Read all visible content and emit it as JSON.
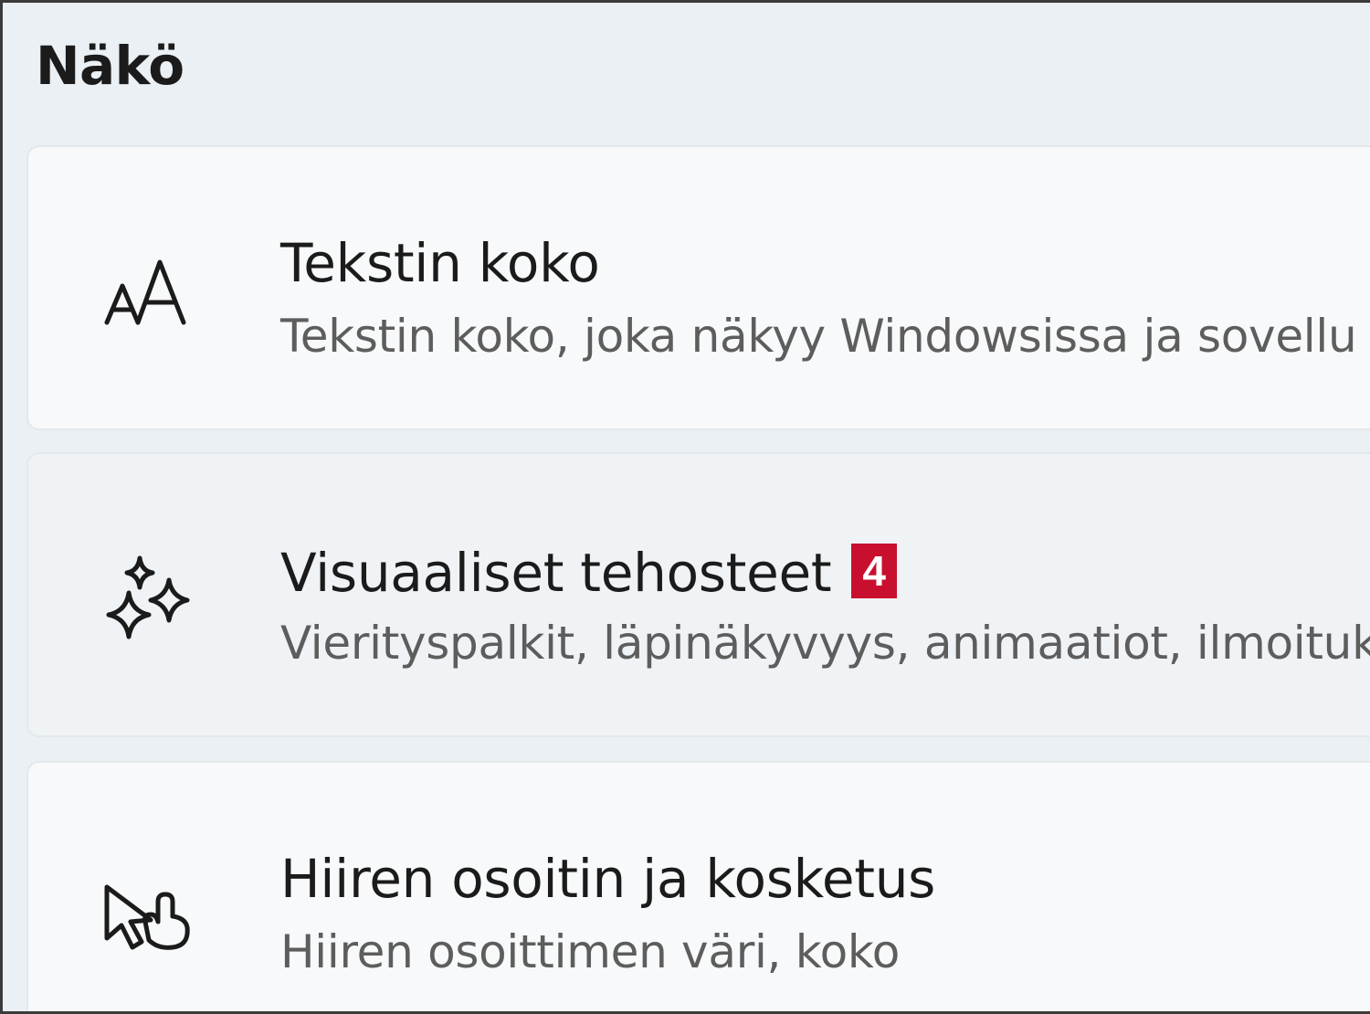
{
  "section": {
    "title": "Näkö"
  },
  "items": [
    {
      "title": "Tekstin koko",
      "description": "Tekstin koko, joka näkyy Windowsissa ja sovellu",
      "icon": "text-size-icon"
    },
    {
      "title": "Visuaaliset tehosteet",
      "badge": "4",
      "description": "Vierityspalkit, läpinäkyvyys, animaatiot, ilmoituk",
      "icon": "sparkle-icon"
    },
    {
      "title": "Hiiren osoitin ja kosketus",
      "description": "Hiiren osoittimen väri, koko",
      "icon": "mouse-pointer-touch-icon"
    }
  ],
  "colors": {
    "badge": "#c8102e",
    "background": "#eaf0f3",
    "card": "#f7f9fa"
  }
}
